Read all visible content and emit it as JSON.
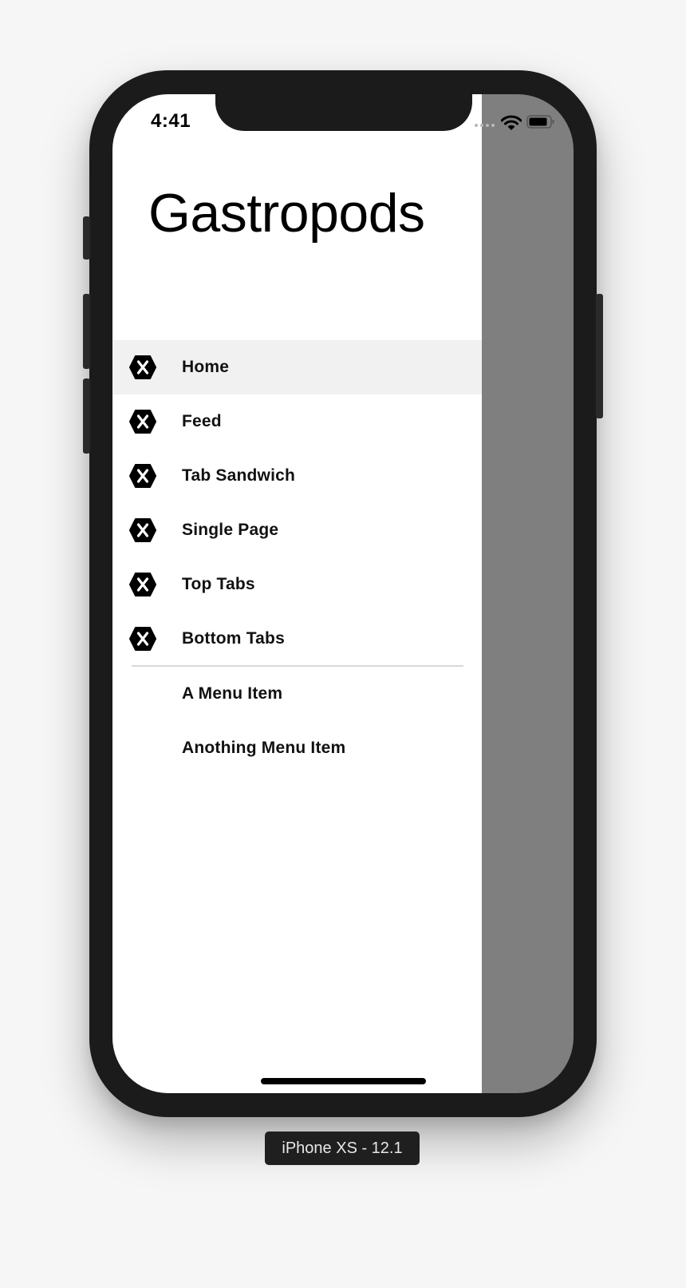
{
  "device": {
    "label": "iPhone XS - 12.1"
  },
  "status_bar": {
    "time": "4:41",
    "icons": [
      "signal-dots-icon",
      "wifi-icon",
      "battery-icon"
    ]
  },
  "flyout": {
    "title": "Gastropods",
    "items": [
      {
        "label": "Home",
        "icon": "xamarin-hexagon-icon",
        "selected": true
      },
      {
        "label": "Feed",
        "icon": "xamarin-hexagon-icon",
        "selected": false
      },
      {
        "label": "Tab Sandwich",
        "icon": "xamarin-hexagon-icon",
        "selected": false
      },
      {
        "label": "Single Page",
        "icon": "xamarin-hexagon-icon",
        "selected": false
      },
      {
        "label": "Top Tabs",
        "icon": "xamarin-hexagon-icon",
        "selected": false
      },
      {
        "label": "Bottom Tabs",
        "icon": "xamarin-hexagon-icon",
        "selected": false
      }
    ],
    "menu_items": [
      {
        "label": "A Menu Item"
      },
      {
        "label": "Anothing Menu Item"
      }
    ],
    "colors": {
      "selected_background": "#f1f1f1",
      "overlay": "#7f7f7f",
      "separator": "#d8d8d8"
    }
  }
}
